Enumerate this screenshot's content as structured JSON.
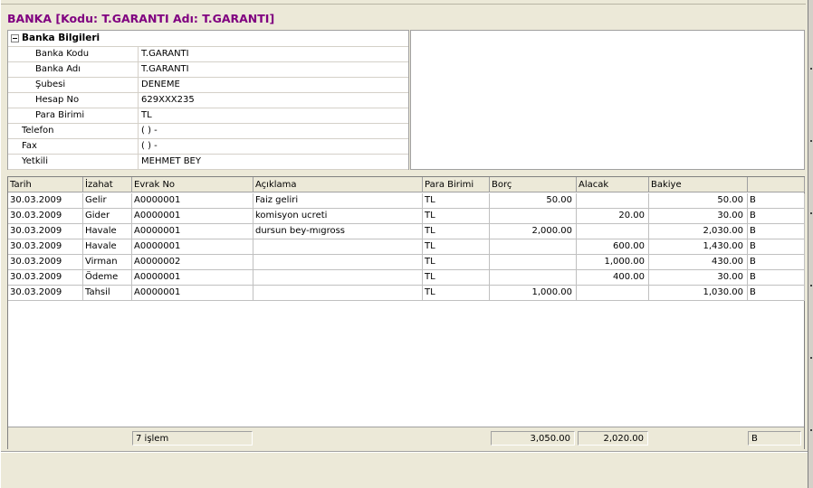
{
  "title": "BANKA [Kodu: T.GARANTI Adı: T.GARANTI]",
  "info": {
    "category": "Banka Bilgileri",
    "properties": [
      {
        "name": "Banka Kodu",
        "value": "T.GARANTI",
        "indent": 1
      },
      {
        "name": "Banka Adı",
        "value": "T.GARANTI",
        "indent": 1
      },
      {
        "name": "Şubesi",
        "value": "DENEME",
        "indent": 1
      },
      {
        "name": "Hesap No",
        "value": "629XXX235",
        "indent": 1
      },
      {
        "name": "Para Birimi",
        "value": "TL",
        "indent": 1
      },
      {
        "name": "Telefon",
        "value": "(   )   -",
        "indent": 0
      },
      {
        "name": "Fax",
        "value": "(   )   -",
        "indent": 0
      },
      {
        "name": "Yetkili",
        "value": "MEHMET BEY",
        "indent": 0
      }
    ]
  },
  "grid": {
    "columns": [
      "Tarih",
      "İzahat",
      "Evrak No",
      "Açıklama",
      "Para Birimi",
      "Borç",
      "Alacak",
      "Bakiye",
      ""
    ],
    "rows": [
      [
        "30.03.2009",
        "Gelir",
        "A0000001",
        "Faiz geliri",
        "TL",
        "50.00",
        "",
        "50.00",
        "B"
      ],
      [
        "30.03.2009",
        "Gider",
        "A0000001",
        "komisyon ucreti",
        "TL",
        "",
        "20.00",
        "30.00",
        "B"
      ],
      [
        "30.03.2009",
        "Havale",
        "A0000001",
        "dursun bey-mıgross",
        "TL",
        "2,000.00",
        "",
        "2,030.00",
        "B"
      ],
      [
        "30.03.2009",
        "Havale",
        "A0000001",
        "",
        "TL",
        "",
        "600.00",
        "1,430.00",
        "B"
      ],
      [
        "30.03.2009",
        "Virman",
        "A0000002",
        "",
        "TL",
        "",
        "1,000.00",
        "430.00",
        "B"
      ],
      [
        "30.03.2009",
        "Ödeme",
        "A0000001",
        "",
        "TL",
        "",
        "400.00",
        "30.00",
        "B"
      ],
      [
        "30.03.2009",
        "Tahsil",
        "A0000001",
        "",
        "TL",
        "1,000.00",
        "",
        "1,030.00",
        "B"
      ]
    ],
    "footer": {
      "count": "7 işlem",
      "borc_total": "3,050.00",
      "alacak_total": "2,020.00",
      "bakiye_flag": "B"
    }
  },
  "colors": {
    "title": "#800080",
    "background": "#ece9d8"
  }
}
